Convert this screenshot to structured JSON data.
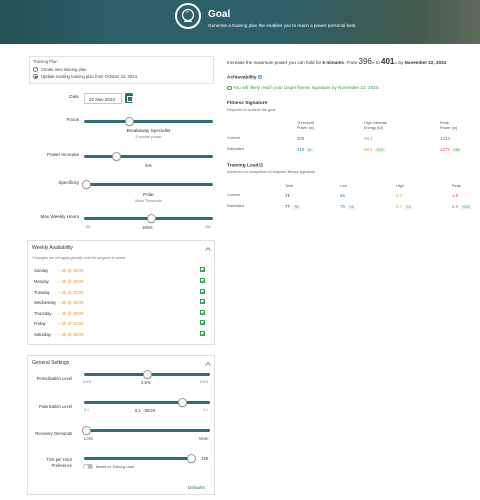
{
  "header": {
    "title": "Goal",
    "subtitle": "Generate a training plan the enables you to reach a power personal best."
  },
  "training_plan": {
    "title": "Training Plan",
    "options": [
      {
        "label": "Create new training plan",
        "checked": false
      },
      {
        "label": "Update existing training plan from October 22, 2024",
        "checked": true
      }
    ]
  },
  "form": {
    "date_label": "Date",
    "date_value": "22 Nov 2024",
    "focus_label": "Focus",
    "focus_value": "Breakaway Specialist",
    "focus_sub": "5 minute power",
    "focus_level": 0.35,
    "power_increase_label": "Power Increase",
    "power_increase_value": "5%",
    "power_increase_level": 0.25,
    "specificity_label": "Specificity",
    "specificity_value": "Polar",
    "specificity_sub": "More Threshold",
    "specificity_level": 0.02,
    "max_weekly_label": "Max Weekly Hours",
    "max_weekly_min": "4h",
    "max_weekly_value": "16hrs",
    "max_weekly_max": "25h",
    "max_weekly_level": 0.52
  },
  "weekly": {
    "title": "Weekly Availability",
    "note": "*Changes are not apply globally until the program is saved",
    "days": [
      {
        "day": "Sunday",
        "value": "~ 2h @ 19:00"
      },
      {
        "day": "Monday",
        "value": "~ 2h @ 19:00"
      },
      {
        "day": "Tuesday",
        "value": "~ 2h @ 19:00"
      },
      {
        "day": "Wednesday",
        "value": "~ 2h @ 19:00"
      },
      {
        "day": "Thursday",
        "value": "~ 2h @ 19:00"
      },
      {
        "day": "Friday",
        "value": "~ 2h @ 19:00"
      },
      {
        "day": "Saturday",
        "value": "~ 2h @ 19:00"
      }
    ]
  },
  "general": {
    "title": "General Settings",
    "periodization_label": "Periodization Level",
    "periodization_min": "0.0%",
    "periodization_value": "2.5%",
    "periodization_max": "5.0%",
    "periodization_level": 0.5,
    "polarization_label": "Polarization Level",
    "polarization_min": "0.1",
    "polarization_value": "0.1 - 80/20",
    "polarization_max": "0.1",
    "polarization_level": 0.78,
    "recovery_label": "Recovery Demands",
    "recovery_min": "Less",
    "recovery_max": "More",
    "recovery_level": 0.02,
    "tss_label_1": "TSS per Hour",
    "tss_label_2": "Preference",
    "tss_value": "150",
    "tss_level": 0.98,
    "toggle_label": "Based on Training Load",
    "defaults_label": "Defaults"
  },
  "summary": {
    "prefix": "Increase the maximum power you can hold for",
    "duration": "5 minutes",
    "from_label": "From",
    "from_value": "396",
    "unit": "w",
    "to_label": "to",
    "to_value": "401",
    "by_label": "by",
    "by_date": "November 22, 2024"
  },
  "achievability": {
    "title": "Achievability",
    "message": "You will likely reach your target fitness signature by November 22, 2024."
  },
  "fitness": {
    "title": "Fitness Signature",
    "subtitle": "Required to achieve the goal",
    "col1a": "Threshold",
    "col1b": "Power (w)",
    "col2a": "High Intensity",
    "col2b": "Energy (kJ)",
    "col3a": "Peak",
    "col3b": "Power (w)",
    "current_label": "Current",
    "estimated_label": "Estimated",
    "current": [
      "306",
      "28.4",
      "1234"
    ],
    "estimated": [
      "310",
      "29.1",
      "1273"
    ],
    "deltas": [
      "+4",
      "+0.7",
      "+39"
    ]
  },
  "load": {
    "title": "Training Load",
    "subtitle": "Achieved on completion of required fitness signature",
    "cols": [
      "Total",
      "Low",
      "High",
      "Peak"
    ],
    "current_label": "Current",
    "estimated_label": "Estimated",
    "current": [
      "71",
      "66",
      "3.7",
      "1.5"
    ],
    "estimated": [
      "77",
      "70",
      "4.7",
      "2.0"
    ],
    "deltas": [
      "+6",
      "+4",
      "+1",
      "+0.5"
    ]
  },
  "colors": {
    "header": "#2d6068",
    "accent": "#2f6d74",
    "blue": "#2e7bbf",
    "orange": "#e0921a",
    "red": "#e23a3a",
    "green": "#2e9e4a"
  }
}
